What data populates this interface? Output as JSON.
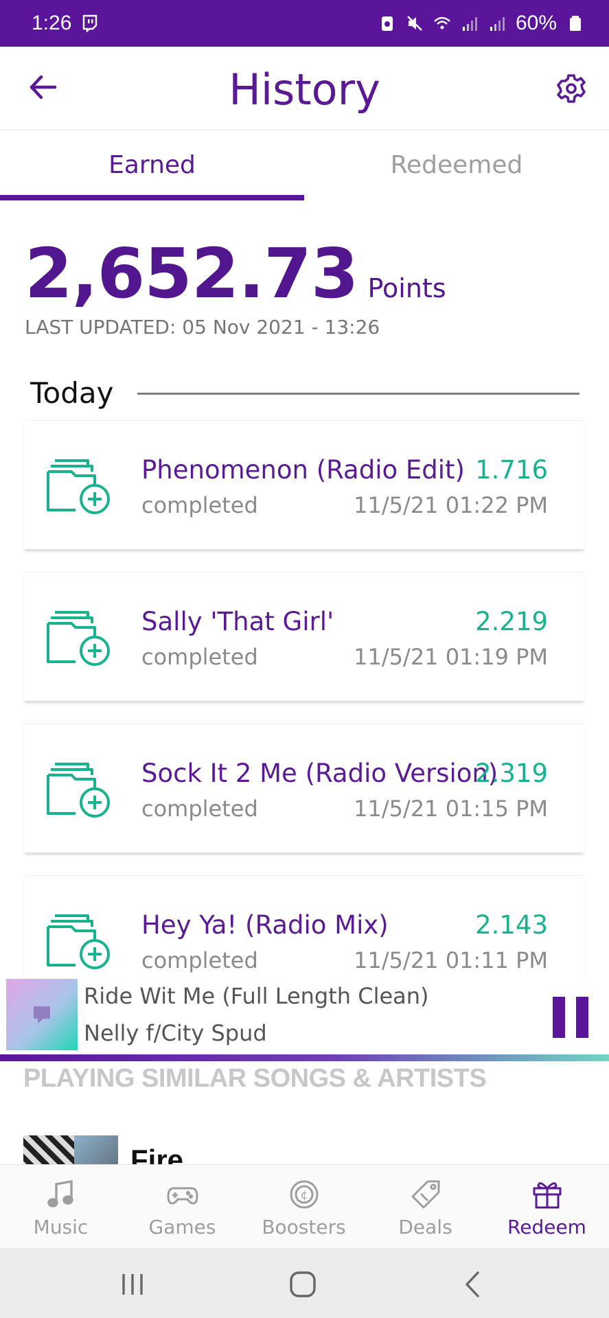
{
  "status_bar": {
    "time": "1:26",
    "battery": "60%"
  },
  "header": {
    "title": "History"
  },
  "tabs": [
    {
      "label": "Earned",
      "active": true
    },
    {
      "label": "Redeemed",
      "active": false
    }
  ],
  "summary": {
    "points": "2,652.73",
    "points_unit": "Points",
    "last_updated": "LAST UPDATED: 05 Nov 2021 - 13:26"
  },
  "section": {
    "label": "Today"
  },
  "history": [
    {
      "title": "Phenomenon (Radio Edit)",
      "points": "1.716",
      "status": "completed",
      "date": "11/5/21 01:22 PM"
    },
    {
      "title": "Sally 'That Girl'",
      "points": "2.219",
      "status": "completed",
      "date": "11/5/21 01:19 PM"
    },
    {
      "title": "Sock It 2 Me (Radio Version)",
      "points": "2.319",
      "status": "completed",
      "date": "11/5/21 01:15 PM"
    },
    {
      "title": "Hey Ya! (Radio Mix)",
      "points": "2.143",
      "status": "completed",
      "date": "11/5/21 01:11 PM"
    }
  ],
  "player": {
    "song": "Ride Wit Me (Full Length Clean)",
    "artist": "Nelly f/City Spud",
    "similar_heading": "PLAYING SIMILAR SONGS & ARTISTS",
    "similar_first": "Fire"
  },
  "bottom_nav": [
    {
      "label": "Music",
      "icon": "music-note-icon",
      "active": false
    },
    {
      "label": "Games",
      "icon": "gamepad-icon",
      "active": false
    },
    {
      "label": "Boosters",
      "icon": "booster-coin-icon",
      "active": false
    },
    {
      "label": "Deals",
      "icon": "tag-icon",
      "active": false
    },
    {
      "label": "Redeem",
      "icon": "gift-icon",
      "active": true
    }
  ],
  "colors": {
    "brand_purple": "#5a159b",
    "accent_green": "#19b28f",
    "muted_gray": "#9e9e9e"
  }
}
